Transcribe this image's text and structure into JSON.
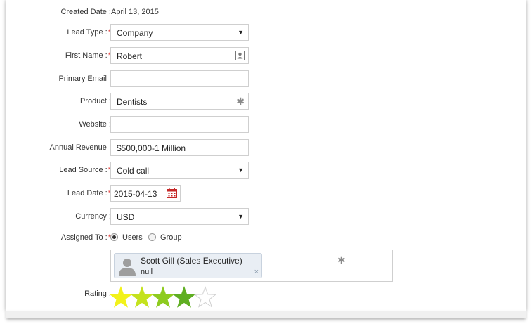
{
  "form": {
    "created_date": {
      "label": "Created Date :",
      "value": "April 13, 2015"
    },
    "lead_type": {
      "label": "Lead Type :",
      "required": "*",
      "value": "Company"
    },
    "first_name": {
      "label": "First Name :",
      "required": "*",
      "value": "Robert"
    },
    "primary_email": {
      "label": "Primary Email :",
      "value": ""
    },
    "product": {
      "label": "Product :",
      "value": "Dentists"
    },
    "website": {
      "label": "Website :",
      "value": ""
    },
    "annual_revenue": {
      "label": "Annual Revenue :",
      "value": "$500,000-1 Million"
    },
    "lead_source": {
      "label": "Lead Source :",
      "required": "*",
      "value": "Cold call"
    },
    "lead_date": {
      "label": "Lead Date :",
      "required": "*",
      "value": "2015-04-13"
    },
    "currency": {
      "label": "Currency :",
      "value": "USD"
    },
    "assigned_to": {
      "label": "Assigned To :",
      "required": "*",
      "options": [
        "Users",
        "Group"
      ],
      "selected": "Users",
      "assignee": {
        "name": "Scott Gill (Sales Executive)",
        "sub": "null",
        "remove": "×"
      }
    },
    "rating": {
      "label": "Rating :",
      "value": 4,
      "max": 5
    }
  },
  "colors": {
    "required": "#e53935",
    "calendar": "#c62828",
    "star_1": "#f2f21a",
    "star_2": "#c4e21e",
    "star_3": "#8ecb1f",
    "star_4": "#5fae22",
    "star_empty_stroke": "#d0d0d0"
  },
  "icons": {
    "select_arrow": "▼",
    "asterisk": "✱"
  }
}
